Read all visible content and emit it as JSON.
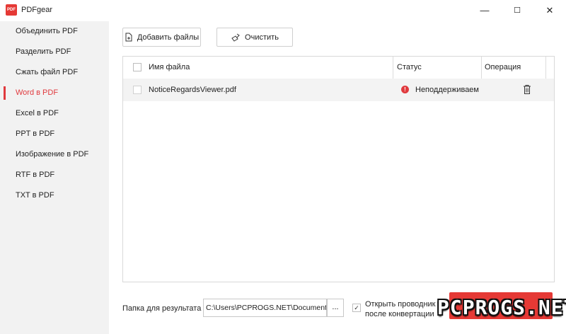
{
  "app": {
    "title": "PDFgear",
    "logo_text": "PDF"
  },
  "window": {
    "minimize": "—",
    "maximize": "☐",
    "close": "✕"
  },
  "sidebar": {
    "items": [
      {
        "label": "Объединить PDF"
      },
      {
        "label": "Разделить PDF"
      },
      {
        "label": "Сжать файл PDF"
      },
      {
        "label": "Word в PDF",
        "active": true
      },
      {
        "label": "Excel в PDF"
      },
      {
        "label": "PPT в PDF"
      },
      {
        "label": "Изображение в PDF"
      },
      {
        "label": "RTF в PDF"
      },
      {
        "label": "TXT в PDF"
      }
    ]
  },
  "toolbar": {
    "add_files_label": "Добавить файлы",
    "clear_label": "Очистить"
  },
  "table": {
    "columns": {
      "name": "Имя файла",
      "status": "Статус",
      "operation": "Операция"
    },
    "rows": [
      {
        "name": "NoticeRegardsViewer.pdf",
        "status": "Неподдерживаемый",
        "status_color": "#e03a3e"
      }
    ]
  },
  "footer": {
    "output_folder_label": "Папка для результата",
    "output_folder_value": "C:\\Users\\PCPROGS.NET\\Documents",
    "browse_label": "...",
    "open_explorer_label_line1": "Открыть проводник",
    "open_explorer_label_line2": "после конвертации",
    "open_explorer_checked": true
  },
  "watermark": {
    "text": "PCPROGS.NET"
  },
  "colors": {
    "accent": "#e03a3e",
    "sidebar_bg": "#f2f2f2",
    "row_bg": "#f3f3f3"
  }
}
